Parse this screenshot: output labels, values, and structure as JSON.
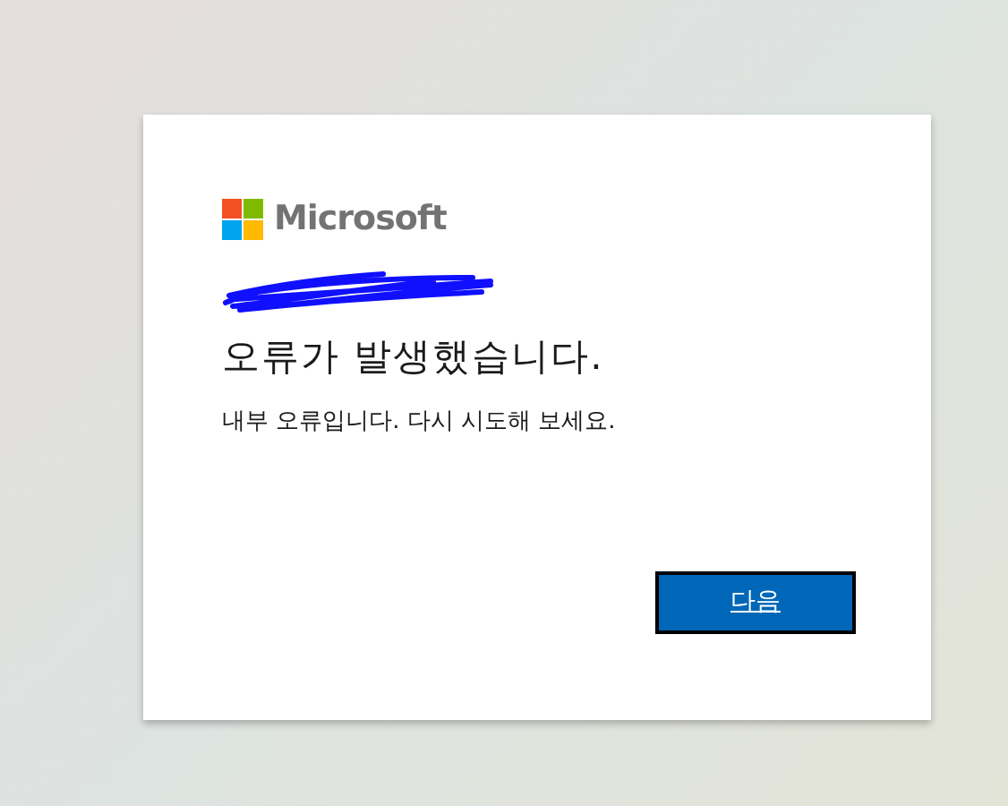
{
  "brand": {
    "name": "Microsoft"
  },
  "title": "오류가 발생했습니다.",
  "message": "내부 오류입니다. 다시 시도해 보세요.",
  "buttons": [
    "다음"
  ]
}
